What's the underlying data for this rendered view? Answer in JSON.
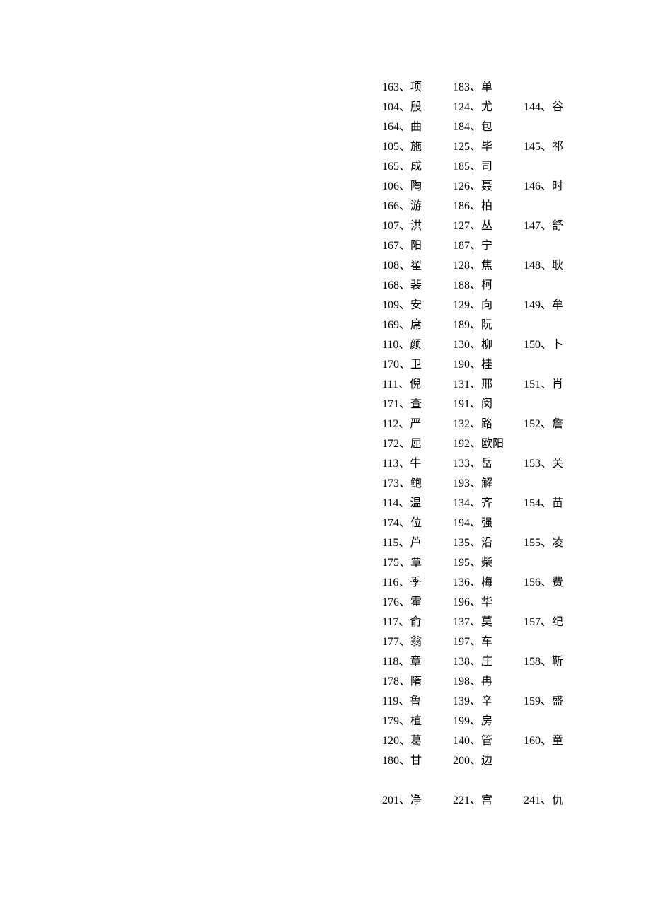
{
  "rows": [
    {
      "c1": "163、项",
      "c2": "183、单",
      "c3": ""
    },
    {
      "c1": "104、殷",
      "c2": "124、尤",
      "c3": "144、谷"
    },
    {
      "c1": "164、曲",
      "c2": "184、包",
      "c3": ""
    },
    {
      "c1": "105、施",
      "c2": "125、毕",
      "c3": "145、祁"
    },
    {
      "c1": "165、成",
      "c2": "185、司",
      "c3": ""
    },
    {
      "c1": "106、陶",
      "c2": "126、聂",
      "c3": "146、时"
    },
    {
      "c1": "166、游",
      "c2": "186、柏",
      "c3": ""
    },
    {
      "c1": "107、洪",
      "c2": "127、丛",
      "c3": "147、舒"
    },
    {
      "c1": "167、阳",
      "c2": "187、宁",
      "c3": ""
    },
    {
      "c1": "108、翟",
      "c2": "128、焦",
      "c3": "148、耿"
    },
    {
      "c1": "168、裴",
      "c2": "188、柯",
      "c3": ""
    },
    {
      "c1": "109、安",
      "c2": "129、向",
      "c3": "149、牟"
    },
    {
      "c1": "169、席",
      "c2": "189、阮",
      "c3": ""
    },
    {
      "c1": "110、颜",
      "c2": "130、柳",
      "c3": "150、卜"
    },
    {
      "c1": "170、卫",
      "c2": "190、桂",
      "c3": ""
    },
    {
      "c1": "111、倪",
      "c2": "131、邢",
      "c3": "151、肖"
    },
    {
      "c1": "171、查",
      "c2": "191、闵",
      "c3": ""
    },
    {
      "c1": "112、严",
      "c2": "132、路",
      "c3": "152、詹"
    },
    {
      "c1": "172、屈",
      "c2": "192、欧阳",
      "c3": ""
    },
    {
      "c1": "113、牛",
      "c2": "133、岳",
      "c3": "153、关"
    },
    {
      "c1": "173、鲍",
      "c2": "193、解",
      "c3": ""
    },
    {
      "c1": "114、温",
      "c2": "134、齐",
      "c3": "154、苗"
    },
    {
      "c1": "174、位",
      "c2": "194、强",
      "c3": ""
    },
    {
      "c1": "115、芦",
      "c2": "135、沿",
      "c3": "155、凌"
    },
    {
      "c1": "175、覃",
      "c2": "195、柴",
      "c3": ""
    },
    {
      "c1": "116、季",
      "c2": "136、梅",
      "c3": "156、费"
    },
    {
      "c1": "176、霍",
      "c2": "196、华",
      "c3": ""
    },
    {
      "c1": "117、俞",
      "c2": "137、莫",
      "c3": "157、纪"
    },
    {
      "c1": "177、翁",
      "c2": "197、车",
      "c3": ""
    },
    {
      "c1": "118、章",
      "c2": "138、庄",
      "c3": "158、靳"
    },
    {
      "c1": "178、隋",
      "c2": "198、冉",
      "c3": ""
    },
    {
      "c1": "119、鲁",
      "c2": "139、辛",
      "c3": "159、盛"
    },
    {
      "c1": "179、植",
      "c2": "199、房",
      "c3": ""
    },
    {
      "c1": "120、葛",
      "c2": "140、管",
      "c3": "160、童"
    },
    {
      "c1": "180、甘",
      "c2": "200、边",
      "c3": ""
    }
  ],
  "last_row": {
    "c1": "201、净",
    "c2": "221、宫",
    "c3": "241、仇"
  }
}
